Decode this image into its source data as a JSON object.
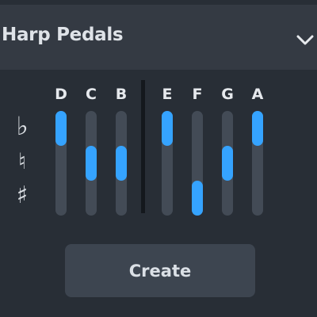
{
  "panel": {
    "title": "Harp Pedals",
    "collapse_icon": "chevron-down-icon"
  },
  "symbols": {
    "flat": "♭",
    "natural": "♮",
    "sharp": "♯"
  },
  "pedals": [
    {
      "note": "D",
      "position": "flat"
    },
    {
      "note": "C",
      "position": "natural"
    },
    {
      "note": "B",
      "position": "natural"
    },
    {
      "note": "E",
      "position": "flat"
    },
    {
      "note": "F",
      "position": "sharp"
    },
    {
      "note": "G",
      "position": "natural"
    },
    {
      "note": "A",
      "position": "flat"
    }
  ],
  "create_button_label": "Create",
  "colors": {
    "knob": "#35a3ff",
    "track": "#434b56",
    "header": "#343a43",
    "background": "#282e36"
  }
}
